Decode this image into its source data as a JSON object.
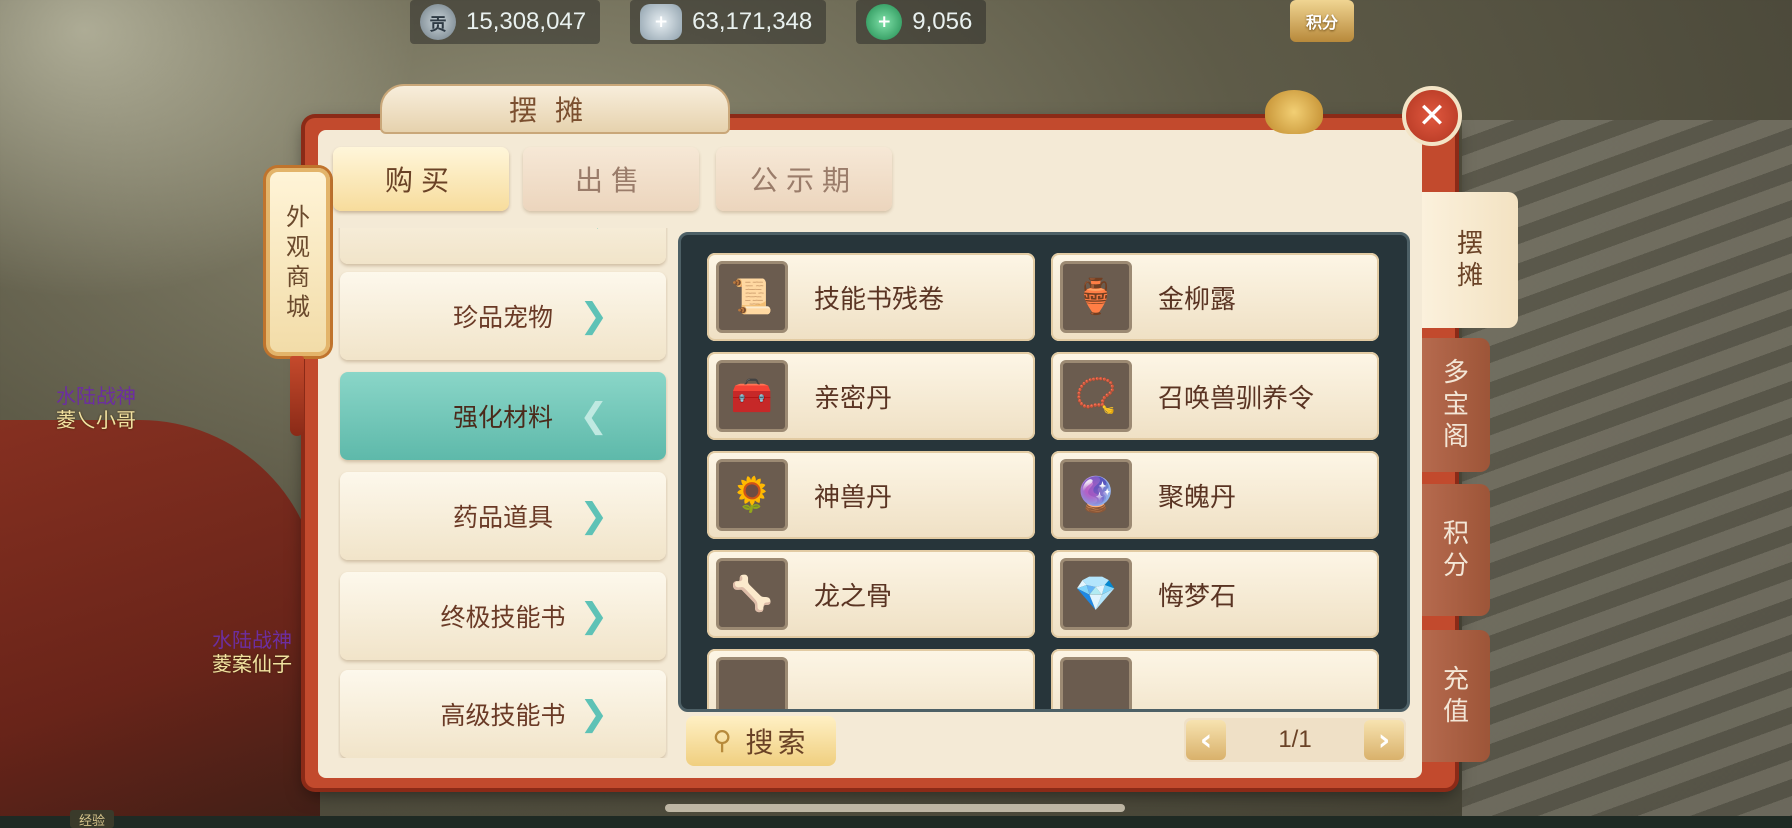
{
  "currencies": [
    {
      "icon": "contribution-coin-icon",
      "glyph": "贡",
      "value": "15,308,047"
    },
    {
      "icon": "silver-ingot-icon",
      "glyph": "+",
      "value": "63,171,348"
    },
    {
      "icon": "jade-icon",
      "glyph": "+",
      "value": "9,056"
    }
  ],
  "score_button": "积分",
  "panel": {
    "title": "摆摊",
    "close": "✕"
  },
  "side_sign": [
    "外",
    "观",
    "商",
    "城"
  ],
  "tabs": {
    "buy": "购买",
    "sell": "出售",
    "notice": "公示期"
  },
  "categories": [
    {
      "label": "珍品宠物",
      "active": false
    },
    {
      "label": "强化材料",
      "active": true
    },
    {
      "label": "药品道具",
      "active": false
    },
    {
      "label": "终极技能书",
      "active": false
    },
    {
      "label": "高级技能书",
      "active": false
    }
  ],
  "items": [
    {
      "name": "技能书残卷",
      "icon": "skill-book-scroll-icon",
      "glyph": "📜"
    },
    {
      "name": "金柳露",
      "icon": "vase-icon",
      "glyph": "🏺"
    },
    {
      "name": "亲密丹",
      "icon": "treasure-chest-icon",
      "glyph": "🧰"
    },
    {
      "name": "召唤兽驯养令",
      "icon": "token-icon",
      "glyph": "📿"
    },
    {
      "name": "神兽丹",
      "icon": "golden-flower-icon",
      "glyph": "🌻"
    },
    {
      "name": "聚魄丹",
      "icon": "crystal-orb-icon",
      "glyph": "🔮"
    },
    {
      "name": "龙之骨",
      "icon": "bone-box-icon",
      "glyph": "🦴"
    },
    {
      "name": "悔梦石",
      "icon": "stone-icon",
      "glyph": "💎"
    }
  ],
  "search": {
    "label": "搜索"
  },
  "pager": {
    "text": "1/1",
    "prev": "‹",
    "next": "›"
  },
  "right_tabs": [
    {
      "chars": [
        "摆",
        "摊"
      ],
      "active": true
    },
    {
      "chars": [
        "多",
        "宝",
        "阁"
      ],
      "active": false
    },
    {
      "chars": [
        "积",
        "分"
      ],
      "active": false
    },
    {
      "chars": [
        "充",
        "值"
      ],
      "active": false
    }
  ],
  "players": [
    {
      "line1": "水陆战神",
      "line2": "菱乀小哥"
    },
    {
      "line1": "水陆战神",
      "line2": "菱案仙子"
    }
  ],
  "exp_label": "经验"
}
